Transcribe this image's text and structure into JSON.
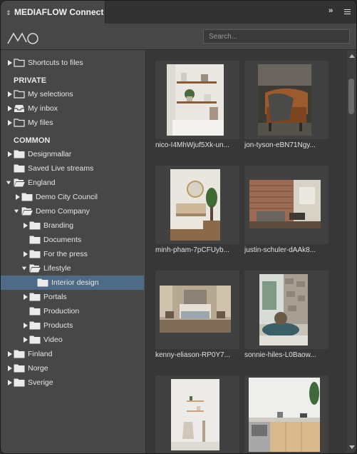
{
  "app": {
    "title": "MEDIAFLOW Connect"
  },
  "search": {
    "placeholder": "Search..."
  },
  "tree": {
    "shortcuts": "Shortcuts to files",
    "private_header": "PRIVATE",
    "my_selections": "My selections",
    "my_inbox": "My inbox",
    "my_files": "My files",
    "common_header": "COMMON",
    "designmallar": "Designmallar",
    "saved_live_streams": "Saved Live streams",
    "england": "England",
    "demo_city_council": "Demo City Council",
    "demo_company": "Demo Company",
    "branding": "Branding",
    "documents": "Documents",
    "for_the_press": "For the press",
    "lifestyle": "Lifestyle",
    "interior_design": "Interior design",
    "portals": "Portals",
    "production": "Production",
    "products": "Products",
    "video": "Video",
    "finland": "Finland",
    "norge": "Norge",
    "sverige": "Sverige"
  },
  "files": [
    {
      "name": "nico-I4MhWjuf5Xk-un..."
    },
    {
      "name": "jon-tyson-eBN71Ngy..."
    },
    {
      "name": "minh-pham-7pCFUyb..."
    },
    {
      "name": "justin-schuler-dAAk8..."
    },
    {
      "name": "kenny-eliason-RP0Y7..."
    },
    {
      "name": "sonnie-hiles-L0Baow..."
    },
    {
      "name": ""
    },
    {
      "name": ""
    }
  ],
  "colors": {
    "selected": "#4d6a87",
    "panel": "#474747",
    "grid": "#373737"
  }
}
